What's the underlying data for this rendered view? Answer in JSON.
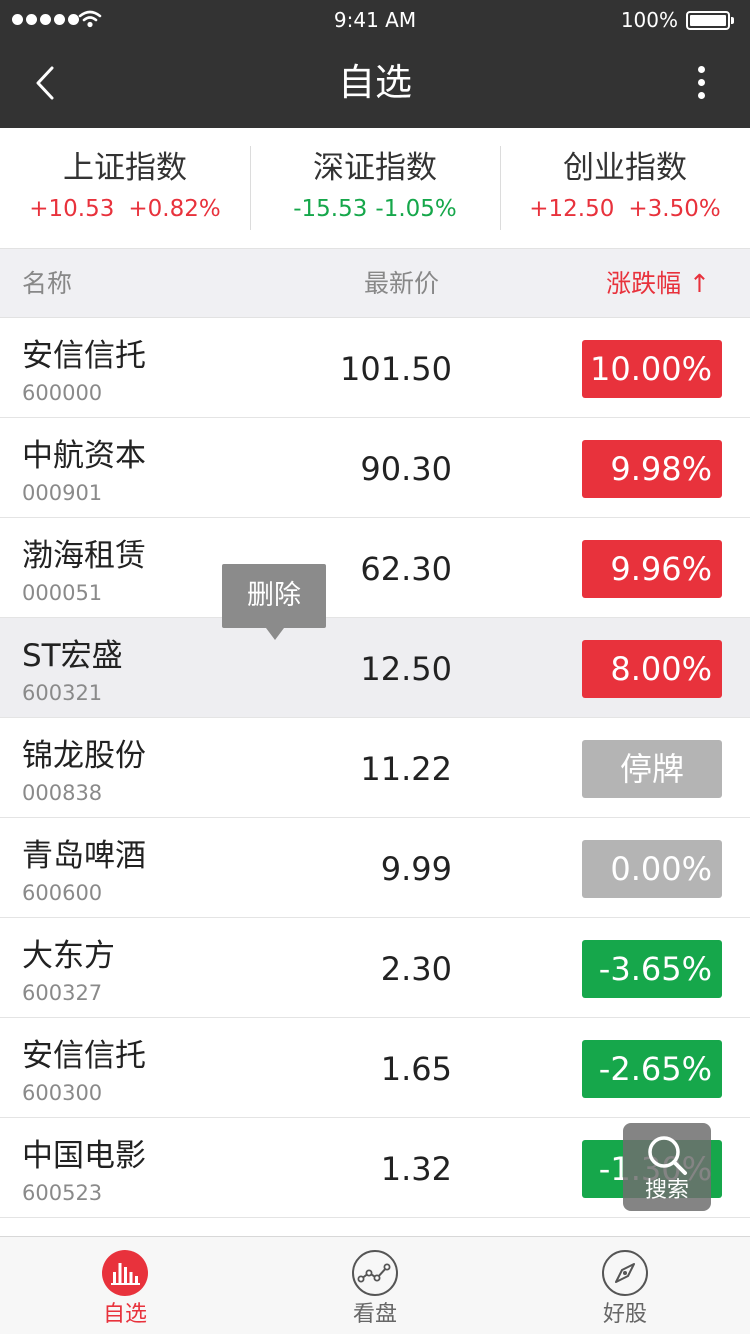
{
  "status_bar": {
    "time": "9:41 AM",
    "battery": "100%"
  },
  "nav": {
    "title": "自选"
  },
  "indices": [
    {
      "name": "上证指数",
      "change": "+10.53",
      "percent": "+0.82%",
      "trend": "up"
    },
    {
      "name": "深证指数",
      "change": "-15.53",
      "percent": "-1.05%",
      "trend": "down"
    },
    {
      "name": "创业指数",
      "change": "+12.50",
      "percent": "+3.50%",
      "trend": "up"
    }
  ],
  "columns": {
    "name": "名称",
    "price": "最新价",
    "change": "涨跌幅 ↑"
  },
  "stocks": [
    {
      "name": "安信信托",
      "code": "600000",
      "price": "101.50",
      "change": "10.00%",
      "color": "red"
    },
    {
      "name": "中航资本",
      "code": "000901",
      "price": "90.30",
      "change": "9.98%",
      "color": "red"
    },
    {
      "name": "渤海租赁",
      "code": "000051",
      "price": "62.30",
      "change": "9.96%",
      "color": "red"
    },
    {
      "name": "ST宏盛",
      "code": "600321",
      "price": "12.50",
      "change": "8.00%",
      "color": "red"
    },
    {
      "name": "锦龙股份",
      "code": "000838",
      "price": "11.22",
      "change": "停牌",
      "color": "gray"
    },
    {
      "name": "青岛啤酒",
      "code": "600600",
      "price": "9.99",
      "change": "0.00%",
      "color": "gray"
    },
    {
      "name": "大东方",
      "code": "600327",
      "price": "2.30",
      "change": "-3.65%",
      "color": "green"
    },
    {
      "name": "安信信托",
      "code": "600300",
      "price": "1.65",
      "change": "-2.65%",
      "color": "green"
    },
    {
      "name": "中国电影",
      "code": "600523",
      "price": "1.32",
      "change": "-1.30%",
      "color": "green"
    }
  ],
  "highlighted_row": 3,
  "tooltip": {
    "label": "删除"
  },
  "search": {
    "label": "搜索"
  },
  "tabs": [
    {
      "label": "自选",
      "icon": "bar-chart-icon",
      "active": true
    },
    {
      "label": "看盘",
      "icon": "trend-line-icon",
      "active": false
    },
    {
      "label": "好股",
      "icon": "compass-icon",
      "active": false
    }
  ],
  "colors": {
    "up": "#e8323c",
    "down": "#16a74b",
    "neutral": "#b4b4b4",
    "header": "#333333"
  }
}
